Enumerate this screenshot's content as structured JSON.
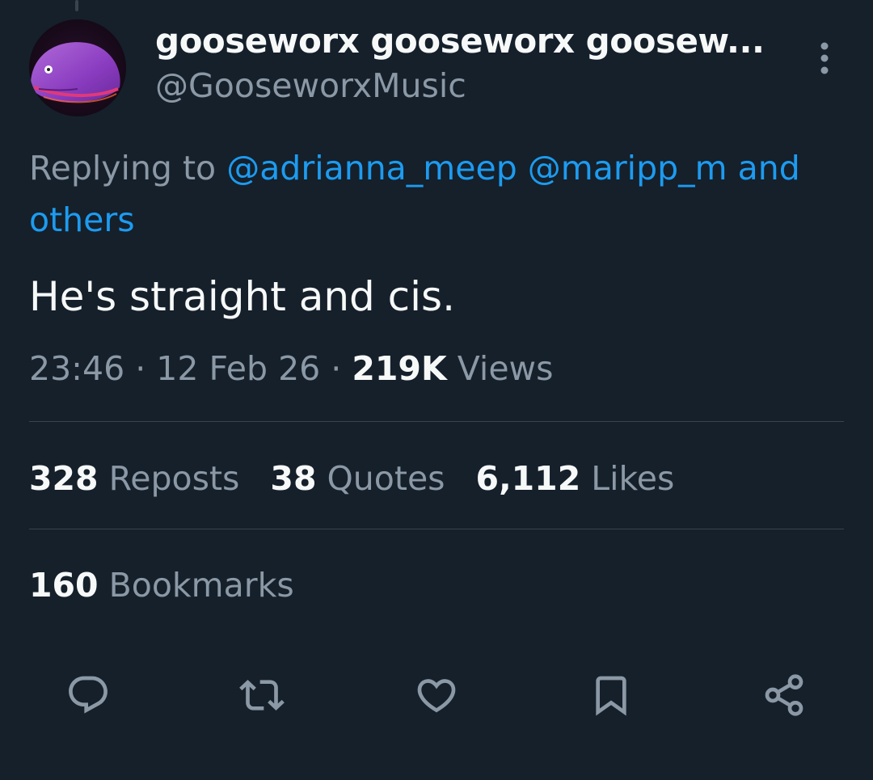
{
  "author": {
    "display_name": "gooseworx gooseworx goosew...",
    "handle": "@GooseworxMusic"
  },
  "reply": {
    "prefix": "Replying to ",
    "mentions": [
      "@adrianna_meep",
      "@maripp_m"
    ],
    "suffix": "and others"
  },
  "tweet": {
    "text": "He's straight and cis."
  },
  "meta": {
    "time": "23:46",
    "separator": " · ",
    "date": "12 Feb 26",
    "views_count": "219K",
    "views_label": "Views"
  },
  "stats": {
    "reposts_count": "328",
    "reposts_label": "Reposts",
    "quotes_count": "38",
    "quotes_label": "Quotes",
    "likes_count": "6,112",
    "likes_label": "Likes",
    "bookmarks_count": "160",
    "bookmarks_label": "Bookmarks"
  },
  "actions": [
    {
      "icon": "reply-icon"
    },
    {
      "icon": "repost-icon"
    },
    {
      "icon": "like-icon"
    },
    {
      "icon": "bookmark-icon"
    },
    {
      "icon": "share-icon"
    }
  ],
  "colors": {
    "background": "#15202b",
    "primary_text": "#f7f9f9",
    "secondary_text": "#8b98a5",
    "link": "#1d9bf0",
    "divider": "#38444d"
  }
}
